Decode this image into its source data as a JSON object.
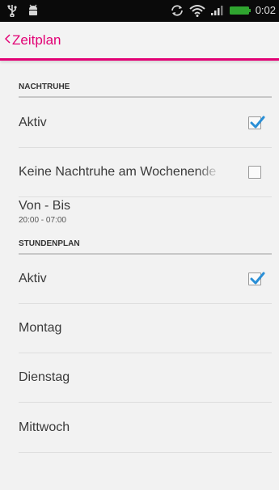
{
  "status_bar": {
    "time": "0:02",
    "icons": [
      "usb-icon",
      "android-debug-icon",
      "sync-icon",
      "wifi-icon",
      "signal-icon",
      "battery-icon"
    ]
  },
  "action_bar": {
    "back_icon": "chevron-left-icon",
    "title": "Zeitplan",
    "accent_color": "#e20074"
  },
  "sections": [
    {
      "header": "NACHTRUHE",
      "items": [
        {
          "label": "Aktiv",
          "checkbox": true,
          "checked": true
        },
        {
          "label": "Keine Nachtruhe am Wochenende",
          "checkbox": true,
          "checked": false
        },
        {
          "label": "Von - Bis",
          "summary": "20:00 - 07:00"
        }
      ]
    },
    {
      "header": "STUNDENPLAN",
      "items": [
        {
          "label": "Aktiv",
          "checkbox": true,
          "checked": true
        },
        {
          "label": "Montag"
        },
        {
          "label": "Dienstag"
        },
        {
          "label": "Mittwoch"
        }
      ]
    }
  ],
  "colors": {
    "checkmark": "#2a8fd6",
    "background": "#f2f2f2"
  }
}
